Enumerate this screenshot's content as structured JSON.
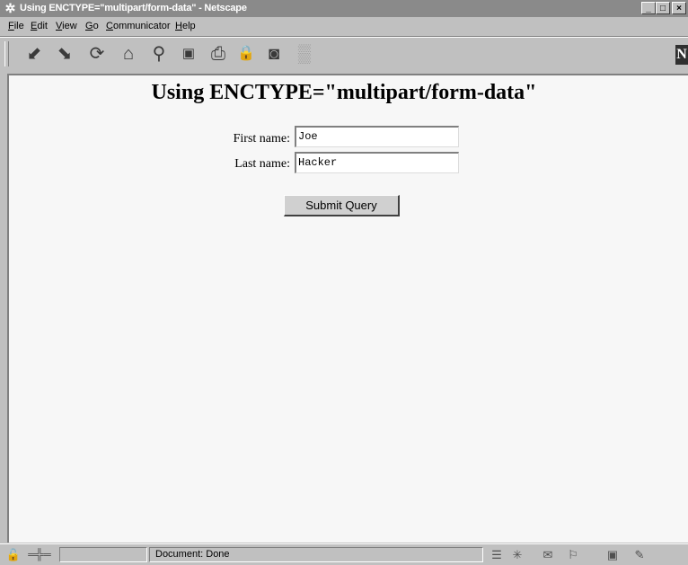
{
  "window": {
    "title": "Using ENCTYPE=\"multipart/form-data\" - Netscape",
    "app_icon": "netscape-icon",
    "controls": {
      "minimize": "_",
      "maximize": "□",
      "close": "×"
    }
  },
  "menubar": {
    "items": [
      {
        "key": "F",
        "rest": "ile"
      },
      {
        "key": "E",
        "rest": "dit"
      },
      {
        "key": "V",
        "rest": "iew"
      },
      {
        "key": "G",
        "rest": "o"
      },
      {
        "key": "C",
        "rest": "ommunicator"
      },
      {
        "key": "H",
        "rest": "elp"
      }
    ]
  },
  "toolbar": {
    "buttons": [
      "back-icon",
      "forward-icon",
      "reload-icon",
      "home-icon",
      "search-icon",
      "my-netscape-icon",
      "print-icon",
      "security-icon",
      "shop-icon",
      "stop-icon"
    ],
    "glyphs": [
      "⬋",
      "⬊",
      "⟳",
      "⌂",
      "⚲",
      "▣",
      "⎙",
      "🔒",
      "◙",
      "▒"
    ],
    "logo_letter": "N"
  },
  "page": {
    "heading": "Using ENCTYPE=\"multipart/form-data\"",
    "form": {
      "first_name_label": "First name:",
      "first_name_value": "Joe",
      "last_name_label": "Last name:",
      "last_name_value": "Hacker",
      "submit_label": "Submit Query"
    }
  },
  "statusbar": {
    "status_text": "Document: Done",
    "icons": [
      "security-lock-icon",
      "connection-icon",
      "component-bar-icons"
    ]
  }
}
